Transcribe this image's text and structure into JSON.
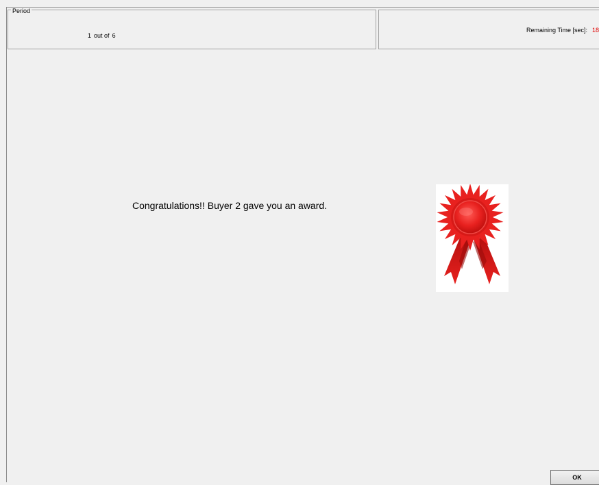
{
  "period_panel": {
    "title": "Period",
    "current": "1",
    "out_of_label": "out of",
    "total": "6"
  },
  "time_panel": {
    "remaining_label": "Remaining Time [sec]:",
    "remaining_value": "18",
    "value_color": "#e00000"
  },
  "main": {
    "message": "Congratulations!! Buyer 2 gave you an award.",
    "award_icon": "award-ribbon-icon",
    "award_color": "#e8211f"
  },
  "footer": {
    "ok_label": "OK"
  }
}
